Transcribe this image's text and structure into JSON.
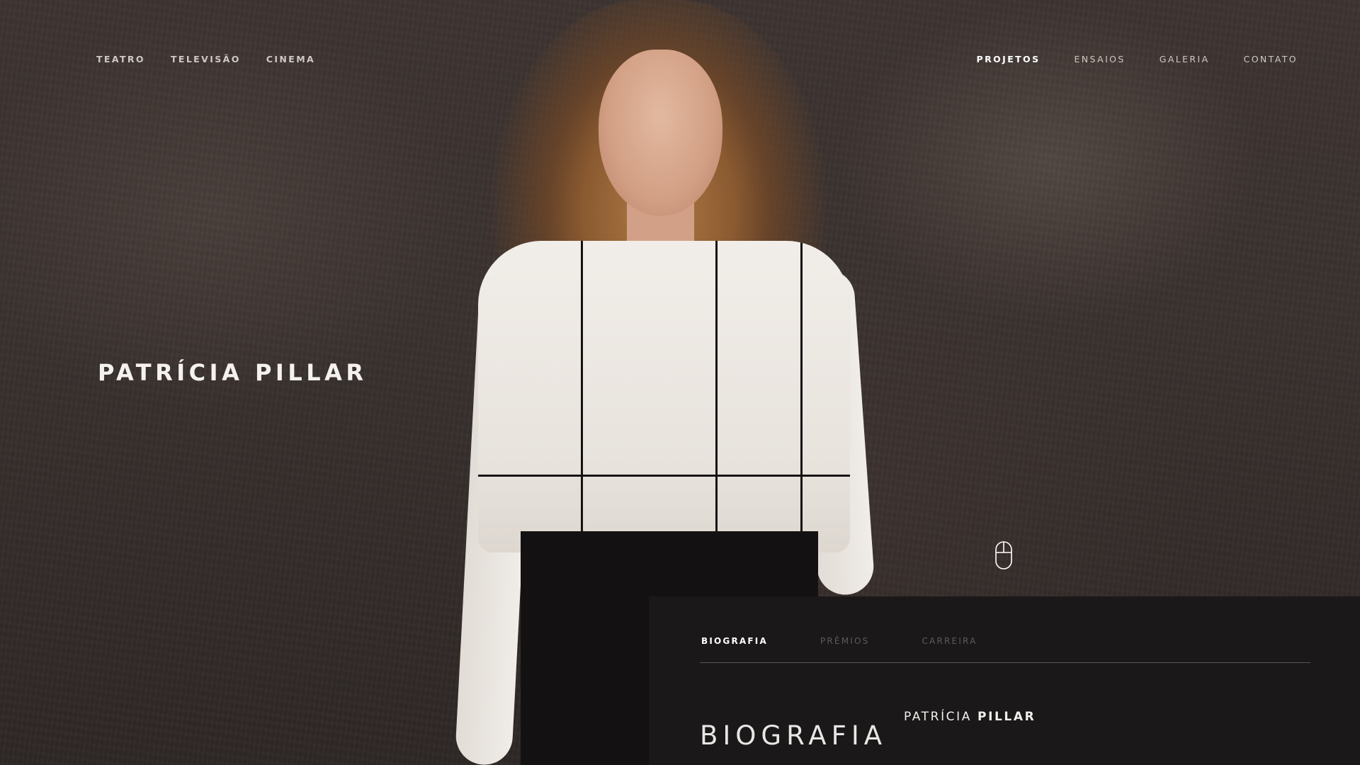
{
  "nav_left": [
    "TEATRO",
    "TELEVISÃO",
    "CINEMA"
  ],
  "nav_right": [
    {
      "label": "PROJETOS",
      "active": true
    },
    {
      "label": "ENSAIOS",
      "active": false
    },
    {
      "label": "GALERIA",
      "active": false
    },
    {
      "label": "CONTATO",
      "active": false
    }
  ],
  "hero": {
    "first_name": "PATRÍCIA",
    "last_name": "PILLAR"
  },
  "scroll_indicator": {
    "icon": "mouse-icon"
  },
  "panel": {
    "tabs": [
      {
        "label": "BIOGRAFIA",
        "active": true
      },
      {
        "label": "PRÊMIOS",
        "active": false
      },
      {
        "label": "CARREIRA",
        "active": false
      }
    ],
    "section_title": "BIOGRAFIA",
    "section_first_name": "PATRÍCIA",
    "section_last_name": "PILLAR"
  },
  "colors": {
    "background": "#3a322f",
    "panel": "#1b1819",
    "text_light": "#f4f1ee",
    "tab_inactive": "#5f5a5a"
  }
}
